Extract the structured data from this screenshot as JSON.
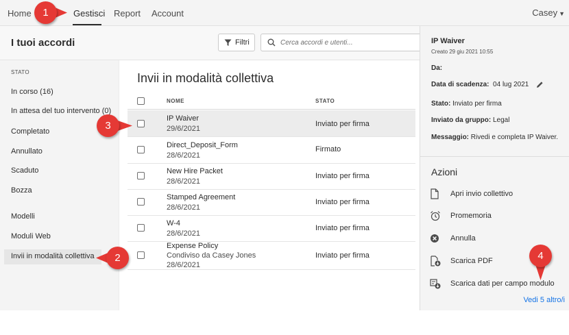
{
  "nav": {
    "items": [
      "Home",
      "Gestisci",
      "Report",
      "Account"
    ],
    "user": "Casey"
  },
  "header": {
    "title": "I tuoi accordi",
    "filter_label": "Filtri",
    "search_placeholder": "Cerca accordi e utenti..."
  },
  "sidebar": {
    "heading": "STATO",
    "status_items": [
      "In corso (16)",
      "In attesa del tuo intervento (0)",
      "Completato",
      "Annullato",
      "Scaduto",
      "Bozza"
    ],
    "other_items": [
      "Modelli",
      "Moduli Web",
      "Invii in modalità collettiva"
    ],
    "active_item": "Invii in modalità collettiva"
  },
  "main": {
    "title": "Invii in modalità collettiva",
    "columns": [
      "NOME",
      "STATO"
    ],
    "rows": [
      {
        "name": "IP Waiver",
        "sub": "",
        "date": "29/6/2021",
        "status": "Inviato per firma"
      },
      {
        "name": "Direct_Deposit_Form",
        "sub": "",
        "date": "28/6/2021",
        "status": "Firmato"
      },
      {
        "name": "New Hire Packet",
        "sub": "",
        "date": "28/6/2021",
        "status": "Inviato per firma"
      },
      {
        "name": "Stamped Agreement",
        "sub": "",
        "date": "28/6/2021",
        "status": "Inviato per firma"
      },
      {
        "name": "W-4",
        "sub": "",
        "date": "28/6/2021",
        "status": "Inviato per firma"
      },
      {
        "name": "Expense Policy",
        "sub": "Condiviso da Casey Jones",
        "date": "28/6/2021",
        "status": "Inviato per firma"
      }
    ]
  },
  "detail": {
    "title": "IP Waiver",
    "created": "Creato 29 giu 2021 10:55",
    "da_label": "Da:",
    "due_label": "Data di scadenza:",
    "due_value": "04 lug 2021",
    "state_label": "Stato:",
    "state_value": "Inviato per firma",
    "group_label": "Inviato da gruppo:",
    "group_value": "Legal",
    "message_label": "Messaggio:",
    "message_value": "Rivedi e completa IP Waiver.",
    "actions_title": "Azioni",
    "actions": [
      {
        "label": "Apri invio collettivo",
        "icon": "document-icon"
      },
      {
        "label": "Promemoria",
        "icon": "alarm-clock-icon"
      },
      {
        "label": "Annulla",
        "icon": "cancel-circle-icon"
      },
      {
        "label": "Scarica PDF",
        "icon": "pdf-download-icon"
      },
      {
        "label": "Scarica dati per campo modulo",
        "icon": "form-data-download-icon"
      }
    ],
    "more_link": "Vedi 5 altro/i"
  },
  "callouts": [
    "1",
    "2",
    "3",
    "4"
  ],
  "colors": {
    "callout": "#e53935",
    "link": "#1473e6",
    "selected_row": "#ececec"
  }
}
